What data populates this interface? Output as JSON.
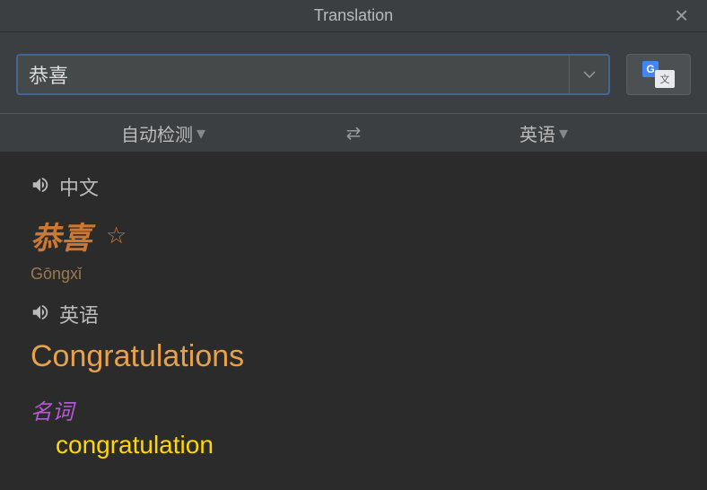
{
  "window": {
    "title": "Translation"
  },
  "search": {
    "value": "恭喜"
  },
  "langBar": {
    "source": "自动检测",
    "target": "英语"
  },
  "result": {
    "sourceLang": "中文",
    "sourceWord": "恭喜",
    "pinyin": "Gōngxǐ",
    "targetLang": "英语",
    "translation": "Congratulations",
    "pos": "名词",
    "definition": "congratulation"
  }
}
